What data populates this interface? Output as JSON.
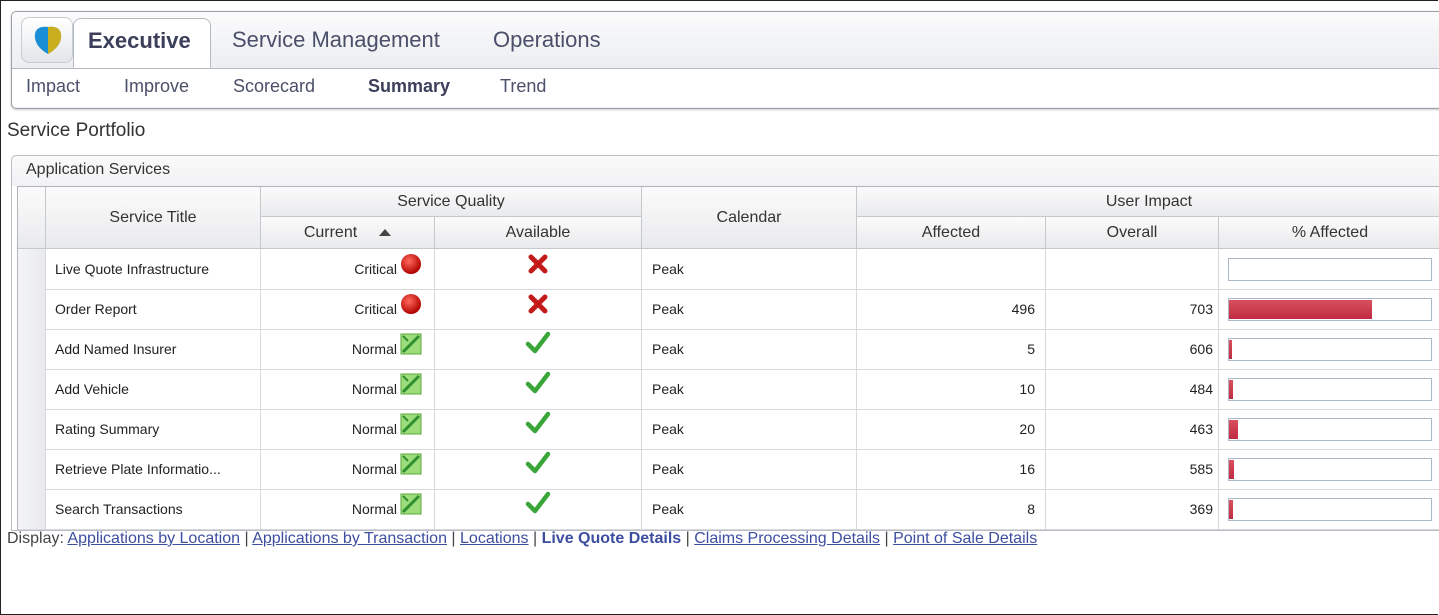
{
  "header": {
    "main_tabs": [
      {
        "label": "Executive",
        "active": true
      },
      {
        "label": "Service Management"
      },
      {
        "label": "Operations"
      }
    ],
    "sub_tabs": [
      {
        "label": "Impact"
      },
      {
        "label": "Improve"
      },
      {
        "label": "Scorecard"
      },
      {
        "label": "Summary",
        "active": true
      },
      {
        "label": "Trend"
      }
    ]
  },
  "page_title": "Service Portfolio",
  "panel_title": "Application Services",
  "table": {
    "headers": {
      "service_title": "Service Title",
      "service_quality": "Service Quality",
      "current": "Current",
      "available": "Available",
      "calendar": "Calendar",
      "user_impact": "User Impact",
      "affected": "Affected",
      "overall": "Overall",
      "pct_affected": "% Affected"
    },
    "rows": [
      {
        "title": "Live Quote Infrastructure",
        "current": "Critical",
        "status_icon": "red-circle-icon",
        "available_icon": "red-x-icon",
        "calendar": "Peak",
        "affected": "",
        "overall": "",
        "pct": 0
      },
      {
        "title": "Order Report",
        "current": "Critical",
        "status_icon": "red-circle-icon",
        "available_icon": "red-x-icon",
        "calendar": "Peak",
        "affected": "496",
        "overall": "703",
        "pct": 0.706
      },
      {
        "title": "Add Named Insurer",
        "current": "Normal",
        "status_icon": "green-check-square-icon",
        "available_icon": "green-checkmark-icon",
        "calendar": "Peak",
        "affected": "5",
        "overall": "606",
        "pct": 0.008
      },
      {
        "title": "Add Vehicle",
        "current": "Normal",
        "status_icon": "green-check-square-icon",
        "available_icon": "green-checkmark-icon",
        "calendar": "Peak",
        "affected": "10",
        "overall": "484",
        "pct": 0.021
      },
      {
        "title": "Rating Summary",
        "current": "Normal",
        "status_icon": "green-check-square-icon",
        "available_icon": "green-checkmark-icon",
        "calendar": "Peak",
        "affected": "20",
        "overall": "463",
        "pct": 0.043
      },
      {
        "title": "Retrieve Plate Informatio...",
        "current": "Normal",
        "status_icon": "green-check-square-icon",
        "available_icon": "green-checkmark-icon",
        "calendar": "Peak",
        "affected": "16",
        "overall": "585",
        "pct": 0.027
      },
      {
        "title": "Search Transactions",
        "current": "Normal",
        "status_icon": "green-check-square-icon",
        "available_icon": "green-checkmark-icon",
        "calendar": "Peak",
        "affected": "8",
        "overall": "369",
        "pct": 0.022
      }
    ]
  },
  "display": {
    "label": "Display:",
    "links": [
      {
        "label": "Applications by Location"
      },
      {
        "label": "Applications by Transaction"
      },
      {
        "label": "Locations"
      },
      {
        "label": "Live Quote Details",
        "current": true
      },
      {
        "label": "Claims Processing Details"
      },
      {
        "label": "Point of Sale Details"
      }
    ]
  },
  "colors": {
    "bar": "#c02a42",
    "critical": "#cc1111",
    "normal": "#3aa63a",
    "link": "#3d4ea0"
  }
}
